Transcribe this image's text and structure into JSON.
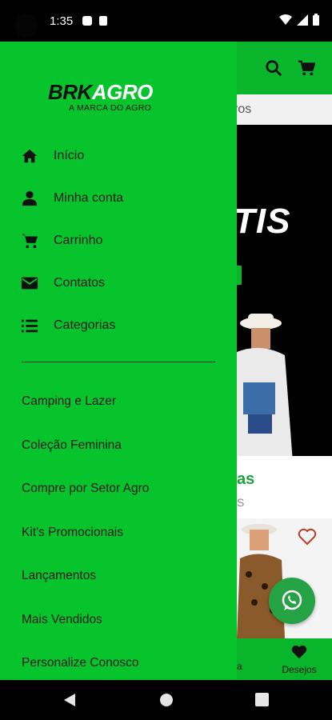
{
  "status_bar": {
    "time": "1:35"
  },
  "app_header": {
    "search_fragment": "ros"
  },
  "banner": {
    "text_fragment": "TIS"
  },
  "section": {
    "title_fragment": "as",
    "sub_fragment": "S"
  },
  "bottom_nav": {
    "item_fragment": "a",
    "wishlist_label": "Desejos"
  },
  "drawer": {
    "logo_brk": "BRK",
    "logo_agro": "AGRO",
    "logo_tagline": "A MARCA DO AGRO",
    "menu": [
      {
        "label": "Início",
        "icon": "home-icon"
      },
      {
        "label": "Minha conta",
        "icon": "person-icon"
      },
      {
        "label": "Carrinho",
        "icon": "cart-icon"
      },
      {
        "label": "Contatos",
        "icon": "mail-icon"
      },
      {
        "label": "Categorias",
        "icon": "list-icon"
      }
    ],
    "categories": [
      "Camping e Lazer",
      "Coleção Feminina",
      "Compre por Setor Agro",
      "Kit's Promocionais",
      "Lançamentos",
      "Mais Vendidos",
      "Personalize Conosco"
    ]
  },
  "colors": {
    "brand_green": "#08c42c",
    "header_green": "#08b52b",
    "whatsapp": "#25a244"
  }
}
